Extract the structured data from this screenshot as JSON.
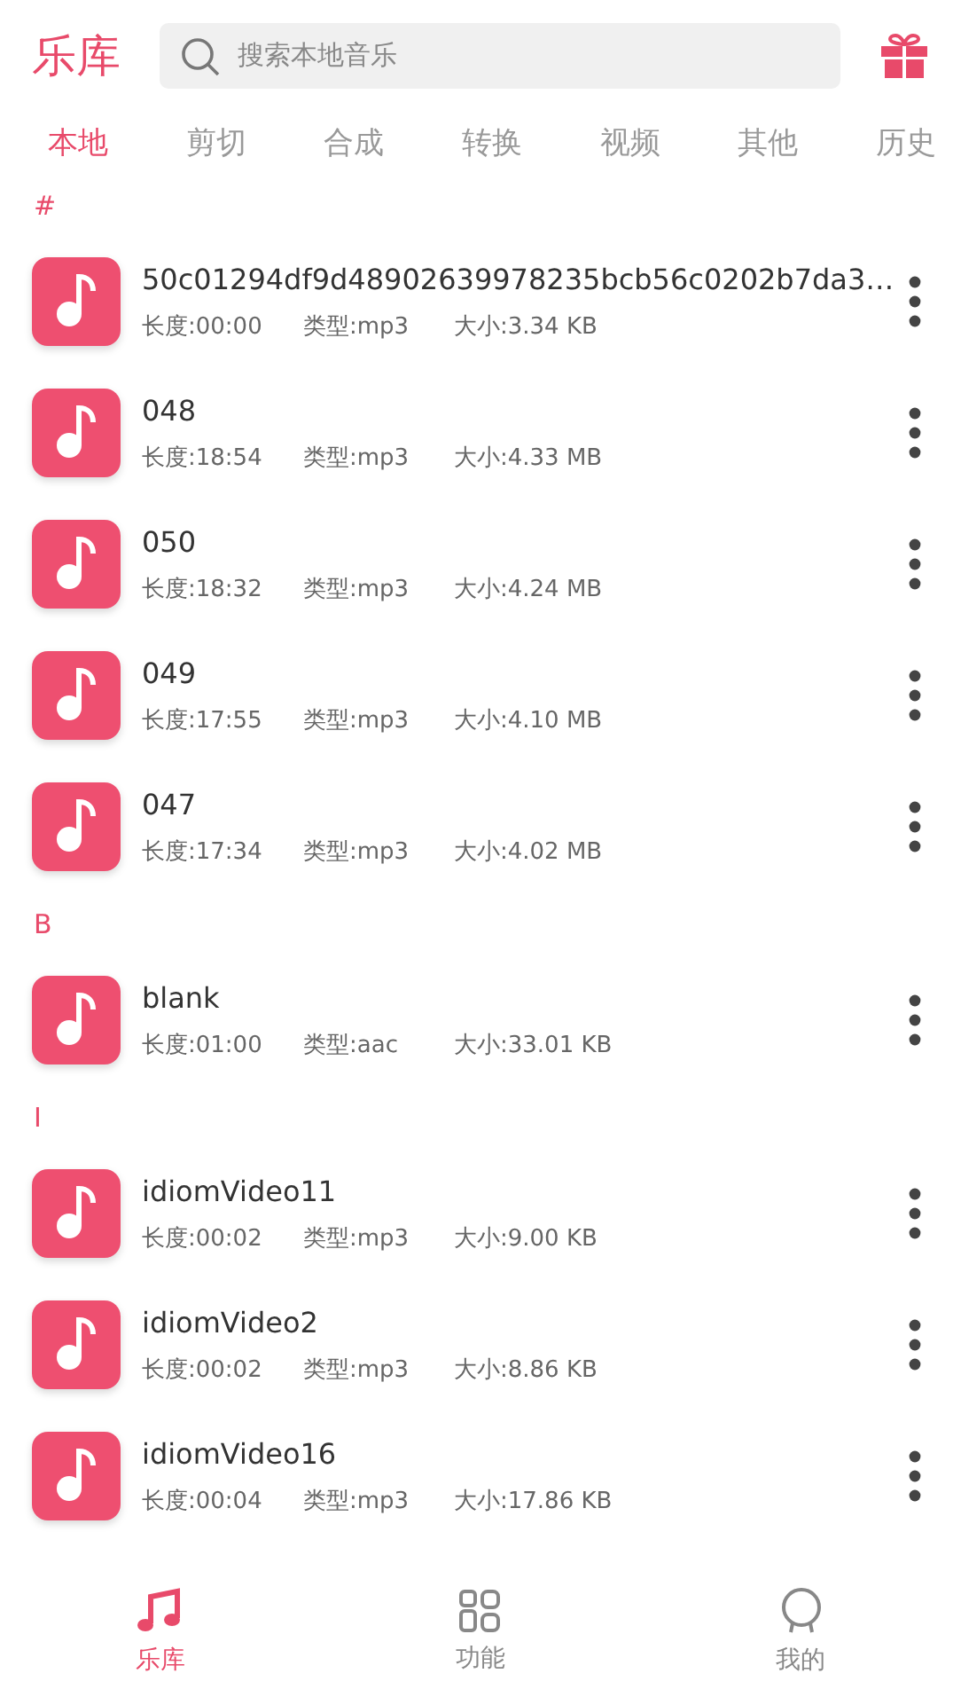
{
  "header": {
    "title": "乐库",
    "search": {
      "placeholder": "搜索本地音乐"
    }
  },
  "tabs": [
    {
      "label": "本地",
      "selected": true
    },
    {
      "label": "剪切",
      "selected": false
    },
    {
      "label": "合成",
      "selected": false
    },
    {
      "label": "转换",
      "selected": false
    },
    {
      "label": "视频",
      "selected": false
    },
    {
      "label": "其他",
      "selected": false
    },
    {
      "label": "历史",
      "selected": false
    }
  ],
  "sections": [
    {
      "letter": "#",
      "items": [
        {
          "title": "50c01294df9d48902639978235bcb56c0202b7da3…",
          "length": "长度:00:00",
          "type": "类型:mp3",
          "size": "大小:3.34 KB"
        },
        {
          "title": "048",
          "length": "长度:18:54",
          "type": "类型:mp3",
          "size": "大小:4.33 MB"
        },
        {
          "title": "050",
          "length": "长度:18:32",
          "type": "类型:mp3",
          "size": "大小:4.24 MB"
        },
        {
          "title": "049",
          "length": "长度:17:55",
          "type": "类型:mp3",
          "size": "大小:4.10 MB"
        },
        {
          "title": "047",
          "length": "长度:17:34",
          "type": "类型:mp3",
          "size": "大小:4.02 MB"
        }
      ]
    },
    {
      "letter": "B",
      "items": [
        {
          "title": "blank",
          "length": "长度:01:00",
          "type": "类型:aac",
          "size": "大小:33.01 KB"
        }
      ]
    },
    {
      "letter": "I",
      "items": [
        {
          "title": "idiomVideo11",
          "length": "长度:00:02",
          "type": "类型:mp3",
          "size": "大小:9.00 KB"
        },
        {
          "title": "idiomVideo2",
          "length": "长度:00:02",
          "type": "类型:mp3",
          "size": "大小:8.86 KB"
        },
        {
          "title": "idiomVideo16",
          "length": "长度:00:04",
          "type": "类型:mp3",
          "size": "大小:17.86 KB"
        }
      ]
    }
  ],
  "bottom_nav": [
    {
      "kind": "music",
      "label": "乐库",
      "selected": true
    },
    {
      "kind": "grid",
      "label": "功能",
      "selected": false
    },
    {
      "kind": "profile",
      "label": "我的",
      "selected": false
    }
  ]
}
